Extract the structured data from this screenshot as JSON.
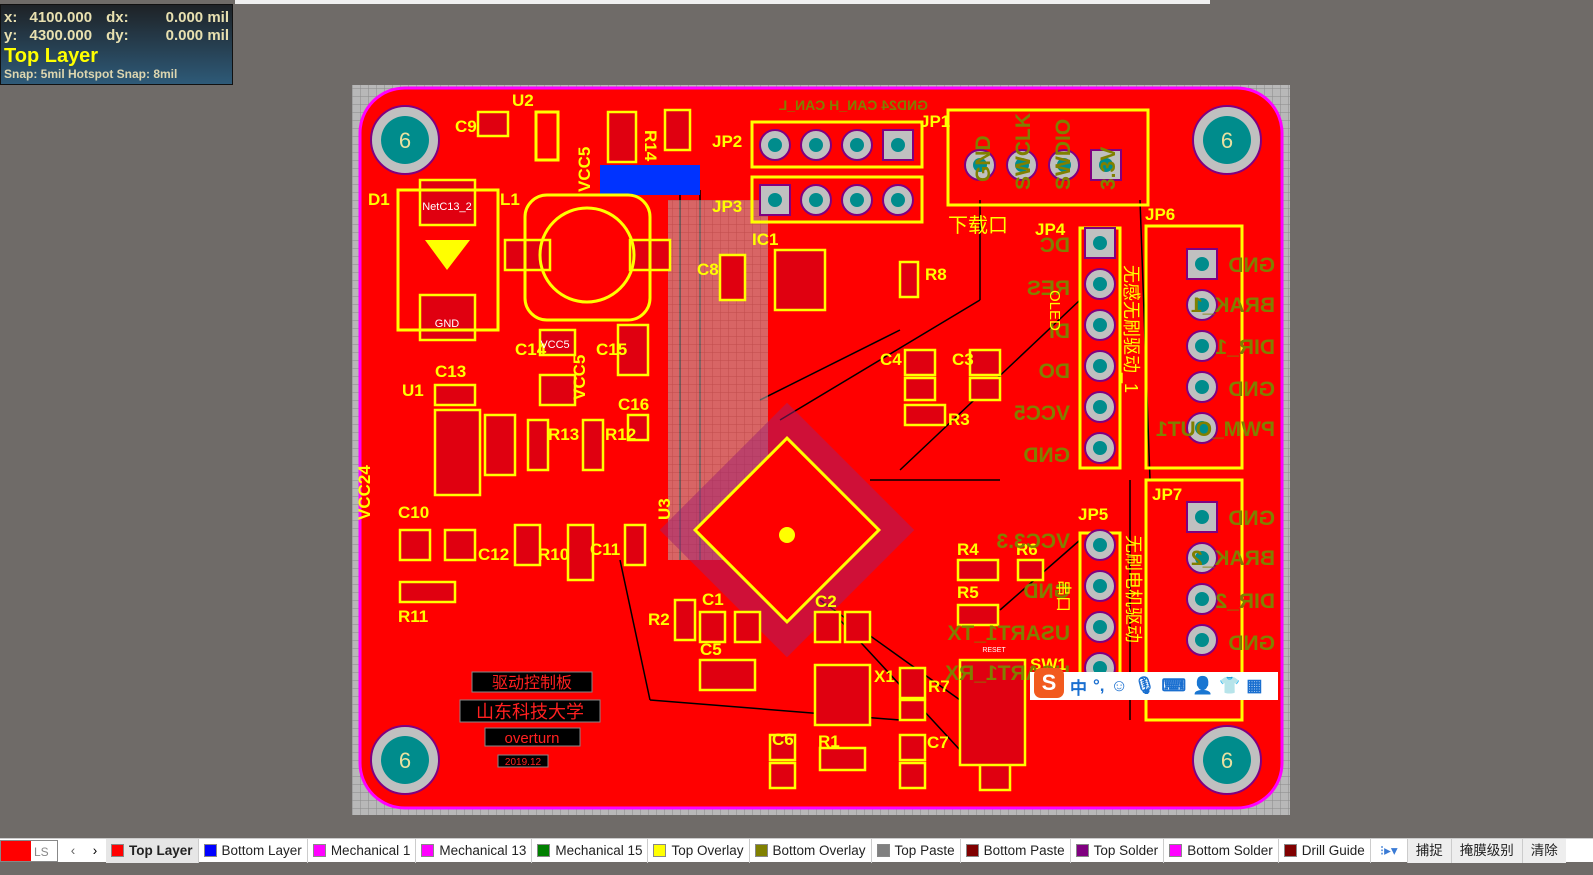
{
  "hud": {
    "x_label": "x:",
    "x_value": "4100.000",
    "dx_label": "dx:",
    "dx_value": "0.000 mil",
    "y_label": "y:",
    "y_value": "4300.000",
    "dy_label": "dy:",
    "dy_value": "0.000 mil",
    "layer": "Top Layer",
    "snap": "Snap: 5mil Hotspot Snap: 8mil"
  },
  "colors": {
    "board": "#ff0000",
    "overlay": "#ffff00",
    "bottom_overlay": "#808000",
    "outline": "#ff00ff",
    "pad": "#c0c0c0",
    "hole": "#008c8c",
    "background": "#6f6b68"
  },
  "board": {
    "mount_hole_label": "6",
    "designators": [
      "U2",
      "C9",
      "D1",
      "L1",
      "C13",
      "U1",
      "C10",
      "C12",
      "R10",
      "C11",
      "R11",
      "R13",
      "R12",
      "C16",
      "C14",
      "C15",
      "JP2",
      "JP3",
      "JP1",
      "IC1",
      "C8",
      "R8",
      "C4",
      "C3",
      "R3",
      "JP4",
      "JP6",
      "JP7",
      "JP5",
      "R4",
      "R6",
      "R5",
      "C1",
      "C2",
      "C5",
      "R2",
      "X1",
      "R7",
      "R1",
      "C6",
      "C7",
      "SW1",
      "R14",
      "VCC24",
      "VCC5",
      "VCC5",
      "U3"
    ],
    "bottom_labels": [
      "GND",
      "BRAK_1",
      "DIR_1",
      "GND",
      "PWM_OUT1",
      "DC",
      "RES",
      "DI",
      "DO",
      "VCC5",
      "GND",
      "GND",
      "BRAK_2",
      "DIR_2",
      "GND",
      "VCC3.3",
      "GND",
      "USART1_TX",
      "USART1_RX",
      "GND",
      "SWCLK",
      "SWDIO",
      "3.3V",
      "GND24 CAN_H CAN_L"
    ],
    "cn_labels": [
      "下载口",
      "OLED",
      "无感无刷驱动_1",
      "无刷电机驱动",
      "串口"
    ],
    "logo_text": [
      "驱动控制板",
      "山东科技大学",
      "overturn",
      "2019.12"
    ],
    "pad_labels": [
      "NetC13_2",
      "GND",
      "VCC5",
      "RESET"
    ]
  },
  "layer_bar": {
    "current": "LS",
    "tabs": [
      {
        "label": "Top Layer",
        "color": "#ff0000",
        "active": true
      },
      {
        "label": "Bottom Layer",
        "color": "#0000ff"
      },
      {
        "label": "Mechanical 1",
        "color": "#ff00ff"
      },
      {
        "label": "Mechanical 13",
        "color": "#ff00ff"
      },
      {
        "label": "Mechanical 15",
        "color": "#008000"
      },
      {
        "label": "Top Overlay",
        "color": "#ffff00"
      },
      {
        "label": "Bottom Overlay",
        "color": "#808000"
      },
      {
        "label": "Top Paste",
        "color": "#808080"
      },
      {
        "label": "Bottom Paste",
        "color": "#800000"
      },
      {
        "label": "Top Solder",
        "color": "#800080"
      },
      {
        "label": "Bottom Solder",
        "color": "#ff00ff"
      },
      {
        "label": "Drill Guide",
        "color": "#800000"
      }
    ],
    "buttons": [
      "捕捉",
      "掩膜级别",
      "清除"
    ]
  },
  "ime": {
    "logo": "S",
    "mode": "中",
    "punct": "°,"
  }
}
